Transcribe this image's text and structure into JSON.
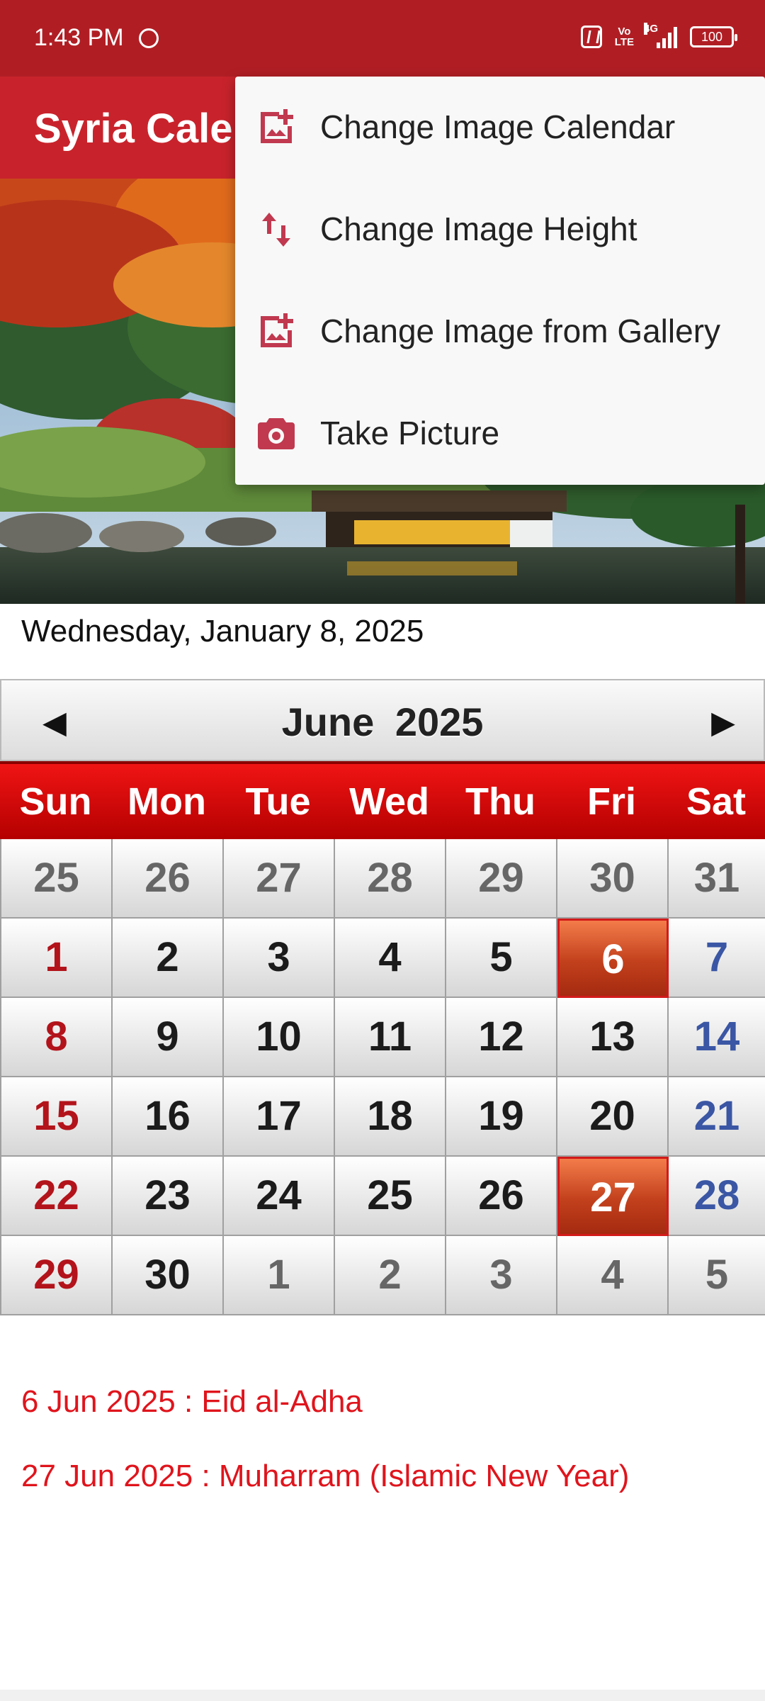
{
  "status_bar": {
    "time": "1:43 PM",
    "volte_top": "Vo",
    "volte_bottom": "LTE",
    "network": "4G",
    "battery": "100"
  },
  "app_bar": {
    "title": "Syria Calendar"
  },
  "today": "Wednesday, January 8, 2025",
  "calendar": {
    "month_title": "June  2025",
    "prev_icon": "◀",
    "next_icon": "▶",
    "weekdays": [
      "Sun",
      "Mon",
      "Tue",
      "Wed",
      "Thu",
      "Fri",
      "Sat"
    ],
    "weeks": [
      [
        "25",
        "26",
        "27",
        "28",
        "29",
        "30",
        "31"
      ],
      [
        "1",
        "2",
        "3",
        "4",
        "5",
        "6",
        "7"
      ],
      [
        "8",
        "9",
        "10",
        "11",
        "12",
        "13",
        "14"
      ],
      [
        "15",
        "16",
        "17",
        "18",
        "19",
        "20",
        "21"
      ],
      [
        "22",
        "23",
        "24",
        "25",
        "26",
        "27",
        "28"
      ],
      [
        "29",
        "30",
        "1",
        "2",
        "3",
        "4",
        "5"
      ]
    ]
  },
  "holidays": [
    "6 Jun 2025 : Eid al-Adha",
    "27 Jun 2025 : Muharram (Islamic New Year)"
  ],
  "menu": {
    "items": [
      {
        "label": "Change Image Calendar",
        "icon": "image-icon"
      },
      {
        "label": "Change Image Height",
        "icon": "swap-vertical-icon"
      },
      {
        "label": "Change Image from Gallery",
        "icon": "image-icon"
      },
      {
        "label": "Take Picture",
        "icon": "camera-icon"
      }
    ]
  },
  "colors": {
    "status_bar": "#b01e24",
    "app_bar": "#c8232c",
    "weekday_row": "#d00000",
    "holiday_cell": "#d9531e",
    "holiday_text": "#e0141c",
    "menu_icon": "#c0394f"
  }
}
